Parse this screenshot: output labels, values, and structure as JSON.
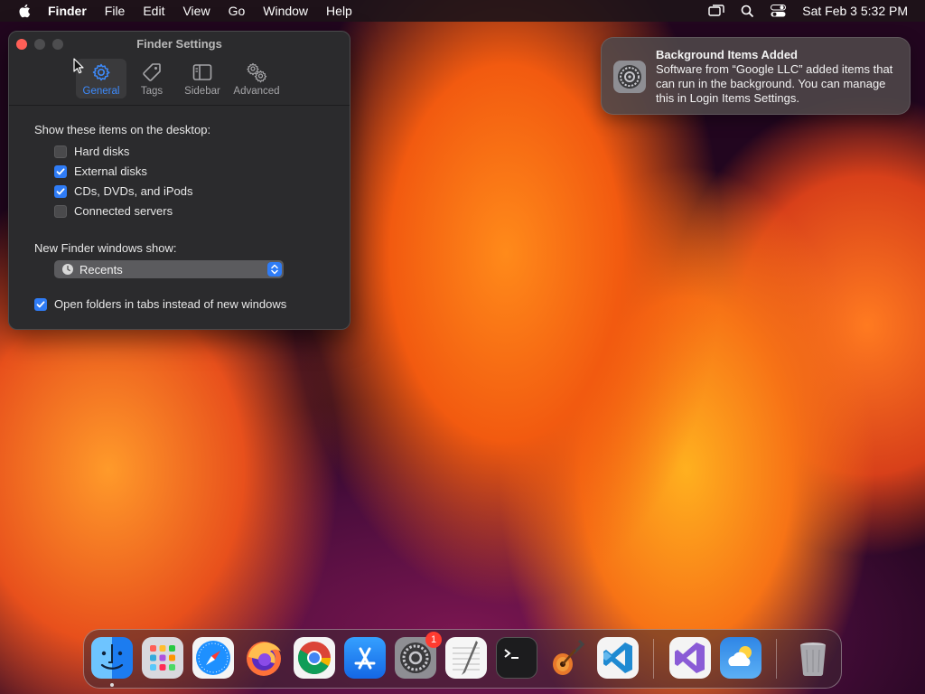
{
  "menubar": {
    "app_name": "Finder",
    "items": [
      "File",
      "Edit",
      "View",
      "Go",
      "Window",
      "Help"
    ],
    "clock": "Sat Feb 3  5:32 PM"
  },
  "finder_settings": {
    "title": "Finder Settings",
    "tabs": [
      {
        "label": "General",
        "icon": "gear-icon",
        "active": true
      },
      {
        "label": "Tags",
        "icon": "tag-icon",
        "active": false
      },
      {
        "label": "Sidebar",
        "icon": "sidebar-icon",
        "active": false
      },
      {
        "label": "Advanced",
        "icon": "gears-icon",
        "active": false
      }
    ],
    "desktop_section_label": "Show these items on the desktop:",
    "desktop_items": [
      {
        "label": "Hard disks",
        "checked": false
      },
      {
        "label": "External disks",
        "checked": true
      },
      {
        "label": "CDs, DVDs, and iPods",
        "checked": true
      },
      {
        "label": "Connected servers",
        "checked": false
      }
    ],
    "new_window_label": "New Finder windows show:",
    "new_window_value": "Recents",
    "open_in_tabs_label": "Open folders in tabs instead of new windows",
    "open_in_tabs_checked": true
  },
  "notification": {
    "title": "Background Items Added",
    "body": "Software from “Google LLC” added items that can run in the background. You can manage this in Login Items Settings.",
    "icon": "system-settings-icon"
  },
  "dock": {
    "apps": [
      {
        "name": "finder-icon",
        "running": true
      },
      {
        "name": "launchpad-icon"
      },
      {
        "name": "safari-icon"
      },
      {
        "name": "firefox-icon"
      },
      {
        "name": "chrome-icon"
      },
      {
        "name": "app-store-icon"
      },
      {
        "name": "system-settings-icon",
        "badge": "1"
      },
      {
        "name": "textedit-icon"
      },
      {
        "name": "terminal-icon"
      },
      {
        "name": "garageband-icon"
      },
      {
        "name": "vscode-icon"
      },
      {
        "name": "visual-studio-icon"
      },
      {
        "name": "weather-icon"
      },
      {
        "name": "trash-icon"
      }
    ]
  }
}
